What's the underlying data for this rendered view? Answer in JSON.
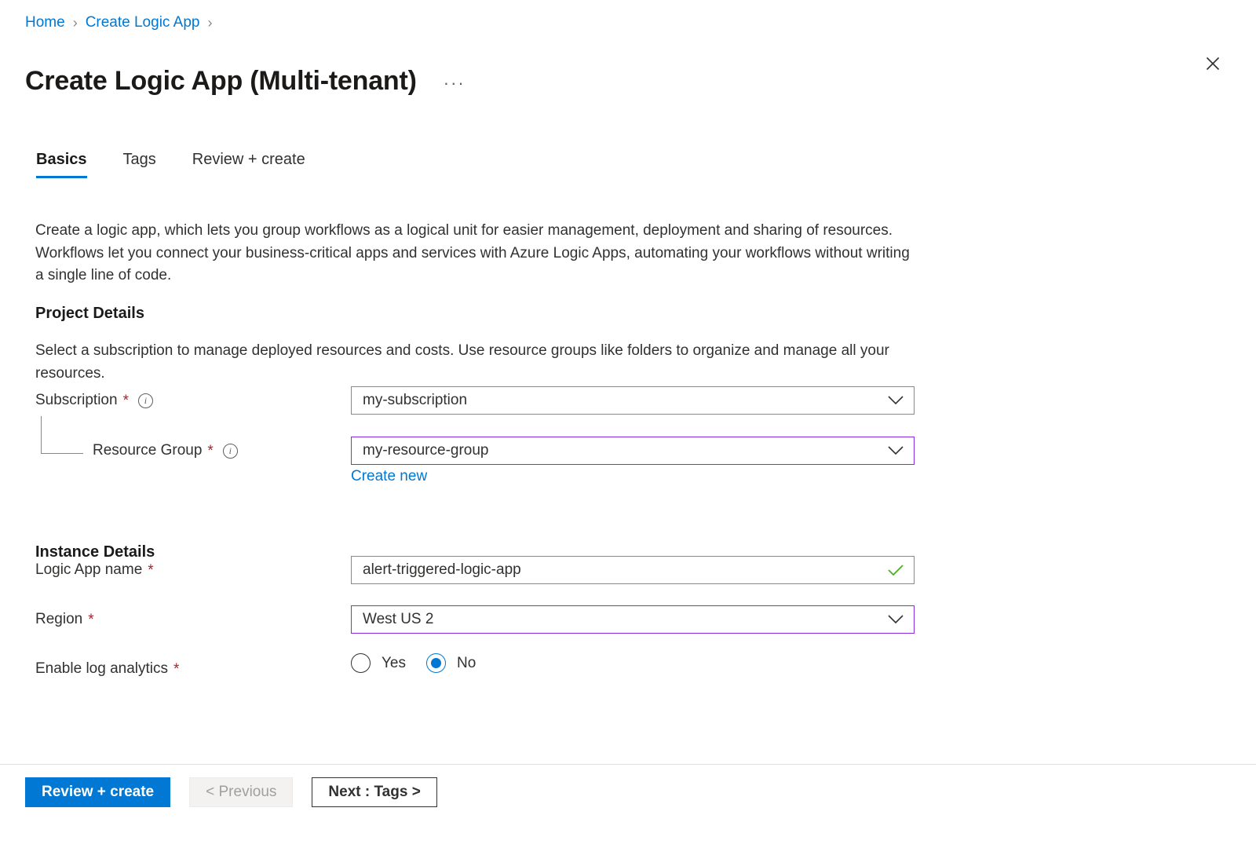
{
  "breadcrumb": {
    "items": [
      {
        "label": "Home"
      },
      {
        "label": "Create Logic App"
      }
    ],
    "separator": "›"
  },
  "header": {
    "title": "Create Logic App (Multi-tenant)",
    "ellipsis_label": "···",
    "close_icon": "close-icon"
  },
  "tabs": [
    {
      "label": "Basics",
      "active": true
    },
    {
      "label": "Tags",
      "active": false
    },
    {
      "label": "Review + create",
      "active": false
    }
  ],
  "intro": {
    "text": "Create a logic app, which lets you group workflows as a logical unit for easier management, deployment and sharing of resources. Workflows let you connect your business-critical apps and services with Azure Logic Apps, automating your workflows without writing a single line of code."
  },
  "project_details": {
    "heading": "Project Details",
    "description": "Select a subscription to manage deployed resources and costs. Use resource groups like folders to organize and manage all your resources.",
    "subscription": {
      "label": "Subscription",
      "required_mark": "*",
      "info_icon": "info-icon",
      "value": "my-subscription",
      "chevron_icon": "chevron-down-icon"
    },
    "resource_group": {
      "label": "Resource Group",
      "required_mark": "*",
      "info_icon": "info-icon",
      "value": "my-resource-group",
      "chevron_icon": "chevron-down-icon",
      "create_new_label": "Create new"
    }
  },
  "instance_details": {
    "heading": "Instance Details",
    "logic_app_name": {
      "label": "Logic App name",
      "required_mark": "*",
      "value": "alert-triggered-logic-app",
      "placeholder": "",
      "validation_icon": "check-icon"
    },
    "region": {
      "label": "Region",
      "required_mark": "*",
      "value": "West US 2",
      "chevron_icon": "chevron-down-icon"
    },
    "enable_log_analytics": {
      "label": "Enable log analytics",
      "required_mark": "*",
      "options": [
        {
          "label": "Yes",
          "selected": false
        },
        {
          "label": "No",
          "selected": true
        }
      ]
    }
  },
  "footer": {
    "review_create_label": "Review + create",
    "previous_label": "< Previous",
    "next_label": "Next : Tags >"
  },
  "colors": {
    "accent_blue": "#0078d4",
    "link_blue": "#0078d4",
    "required_red": "#a4262c",
    "focus_purple": "#8a2be2",
    "success_green": "#4caf20",
    "border_grey": "#8a8886",
    "divider_grey": "#e1dfdd"
  }
}
